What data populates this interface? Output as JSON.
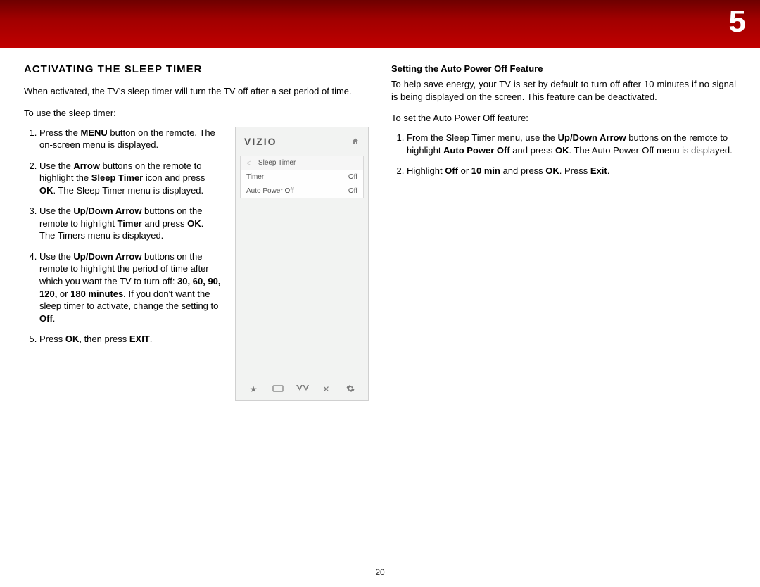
{
  "chapter_number": "5",
  "page_number": "20",
  "left": {
    "title": "ACTIVATING THE SLEEP TIMER",
    "intro": "When activated, the TV's sleep timer will turn the TV off after a set period of time.",
    "lead": "To use the sleep timer:",
    "step1_a": "Press the ",
    "step1_b": "MENU",
    "step1_c": " button on the remote. The on-screen menu is displayed.",
    "step2_a": "Use the ",
    "step2_b": "Arrow",
    "step2_c": " buttons on the remote to highlight the ",
    "step2_d": "Sleep Timer",
    "step2_e": " icon and press ",
    "step2_f": "OK",
    "step2_g": ". The Sleep Timer menu is displayed.",
    "step3_a": "Use the ",
    "step3_b": "Up/Down Arrow",
    "step3_c": " buttons on the remote to highlight ",
    "step3_d": "Timer",
    "step3_e": " and press ",
    "step3_f": "OK",
    "step3_g": ". The Timers menu is displayed.",
    "step4_a": "Use the ",
    "step4_b": "Up/Down Arrow",
    "step4_c": " buttons on the remote to highlight the period of time after which you want the TV to turn off: ",
    "step4_d": "30, 60, 90, 120,",
    "step4_e": " or ",
    "step4_f": "180 minutes.",
    "step4_g": " If you don't want the sleep timer to activate, change the setting to ",
    "step4_h": "Off",
    "step4_i": ".",
    "step5_a": "Press ",
    "step5_b": "OK",
    "step5_c": ", then press ",
    "step5_d": "EXIT",
    "step5_e": "."
  },
  "tv_menu": {
    "brand": "VIZIO",
    "header": "Sleep Timer",
    "row1_label": "Timer",
    "row1_value": "Off",
    "row2_label": "Auto Power Off",
    "row2_value": "Off"
  },
  "right": {
    "subtitle": "Setting the Auto Power Off Feature",
    "intro": "To help save energy, your TV is set by default to turn off after 10 minutes if no signal is being displayed on the screen. This feature can be deactivated.",
    "lead": "To set the Auto Power Off feature:",
    "step1_a": "From the Sleep Timer menu, use the ",
    "step1_b": "Up/Down Arrow",
    "step1_c": " buttons on the remote to highlight ",
    "step1_d": "Auto Power Off",
    "step1_e": " and press ",
    "step1_f": "OK",
    "step1_g": ". The Auto Power-Off menu is displayed.",
    "step2_a": "Highlight ",
    "step2_b": "Off",
    "step2_c": " or ",
    "step2_d": "10 min",
    "step2_e": " and press ",
    "step2_f": "OK",
    "step2_g": ". Press ",
    "step2_h": "Exit",
    "step2_i": "."
  }
}
